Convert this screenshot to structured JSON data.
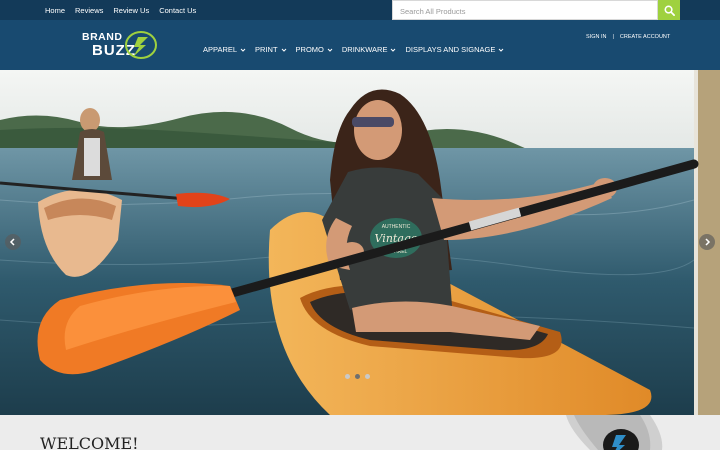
{
  "topnav": {
    "links": [
      "Home",
      "Reviews",
      "Review Us",
      "Contact Us"
    ]
  },
  "search": {
    "placeholder": "Search All Products",
    "icon": "search-icon"
  },
  "logo": {
    "line1": "BRAND",
    "line2": "BUZZ"
  },
  "account": {
    "sign_in": "SIGN IN",
    "separator": "|",
    "create": "CREATE ACCOUNT"
  },
  "mainnav": {
    "items": [
      "APPAREL",
      "PRINT",
      "PROMO",
      "DRINKWARE",
      "DISPLAYS AND SIGNAGE"
    ]
  },
  "hero": {
    "shirt_text": "AUTHENTIC Vintage APPAREL",
    "active_slide": 2,
    "slide_count": 3
  },
  "welcome": {
    "title": "WELCOME!"
  },
  "colors": {
    "topbar": "#133a59",
    "header": "#184a70",
    "accent": "#9fd13f"
  }
}
